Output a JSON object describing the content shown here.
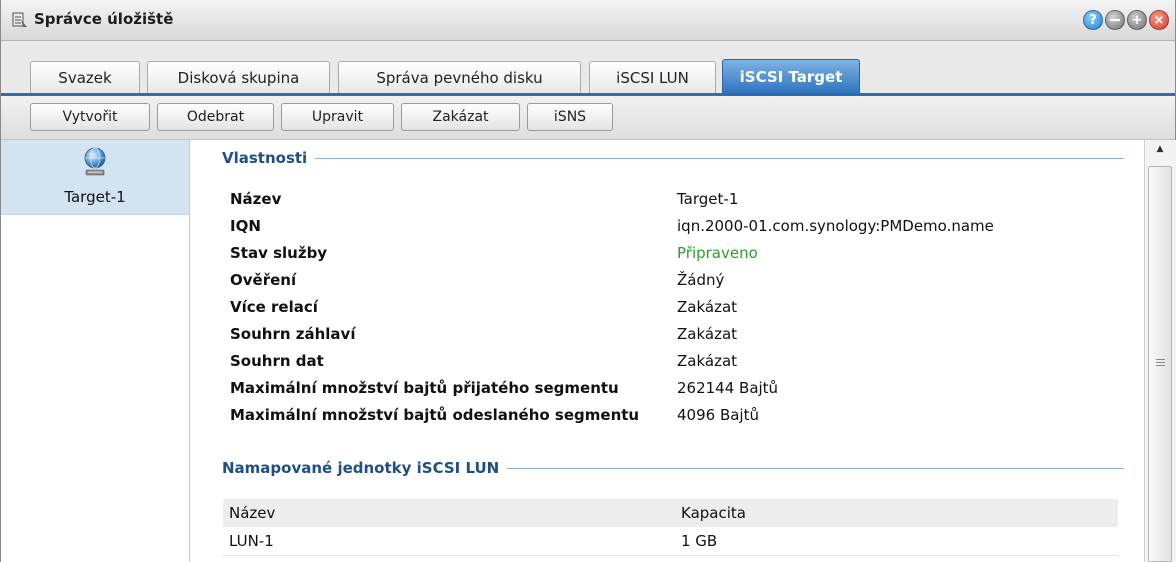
{
  "window": {
    "title": "Správce úložiště",
    "controls": [
      "help-icon",
      "minimize-icon",
      "maximize-icon",
      "close-icon"
    ]
  },
  "tabs": [
    {
      "label": "Svazek",
      "active": false
    },
    {
      "label": "Disková skupina",
      "active": false
    },
    {
      "label": "Správa pevného disku",
      "active": false
    },
    {
      "label": "iSCSI LUN",
      "active": false
    },
    {
      "label": "iSCSI Target",
      "active": true
    }
  ],
  "toolbar": {
    "buttons": [
      "Vytvořit",
      "Odebrat",
      "Upravit",
      "Zakázat",
      "iSNS"
    ]
  },
  "sidebar": {
    "items": [
      {
        "label": "Target-1",
        "icon": "globe-icon",
        "selected": true
      }
    ]
  },
  "properties": {
    "section_title": "Vlastnosti",
    "rows": [
      {
        "label": "Název",
        "value": "Target-1"
      },
      {
        "label": "IQN",
        "value": "iqn.2000-01.com.synology:PMDemo.name"
      },
      {
        "label": "Stav služby",
        "value": "Připraveno"
      },
      {
        "label": "Ověření",
        "value": "Žádný"
      },
      {
        "label": "Více relací",
        "value": "Zakázat"
      },
      {
        "label": "Souhrn záhlaví",
        "value": "Zakázat"
      },
      {
        "label": "Souhrn dat",
        "value": "Zakázat"
      },
      {
        "label": "Maximální množství bajtů přijatého segmentu",
        "value": "262144 Bajtů"
      },
      {
        "label": "Maximální množství bajtů odeslaného segmentu",
        "value": "4096 Bajtů"
      }
    ]
  },
  "mapped_luns": {
    "section_title": "Namapované jednotky iSCSI LUN",
    "columns": [
      "Název",
      "Kapacita"
    ],
    "rows": [
      [
        "LUN-1",
        "1 GB"
      ]
    ]
  },
  "colors": {
    "accent": "#2d6db1",
    "status_ok": "#2aa02a",
    "section_title": "#1f4f83"
  }
}
